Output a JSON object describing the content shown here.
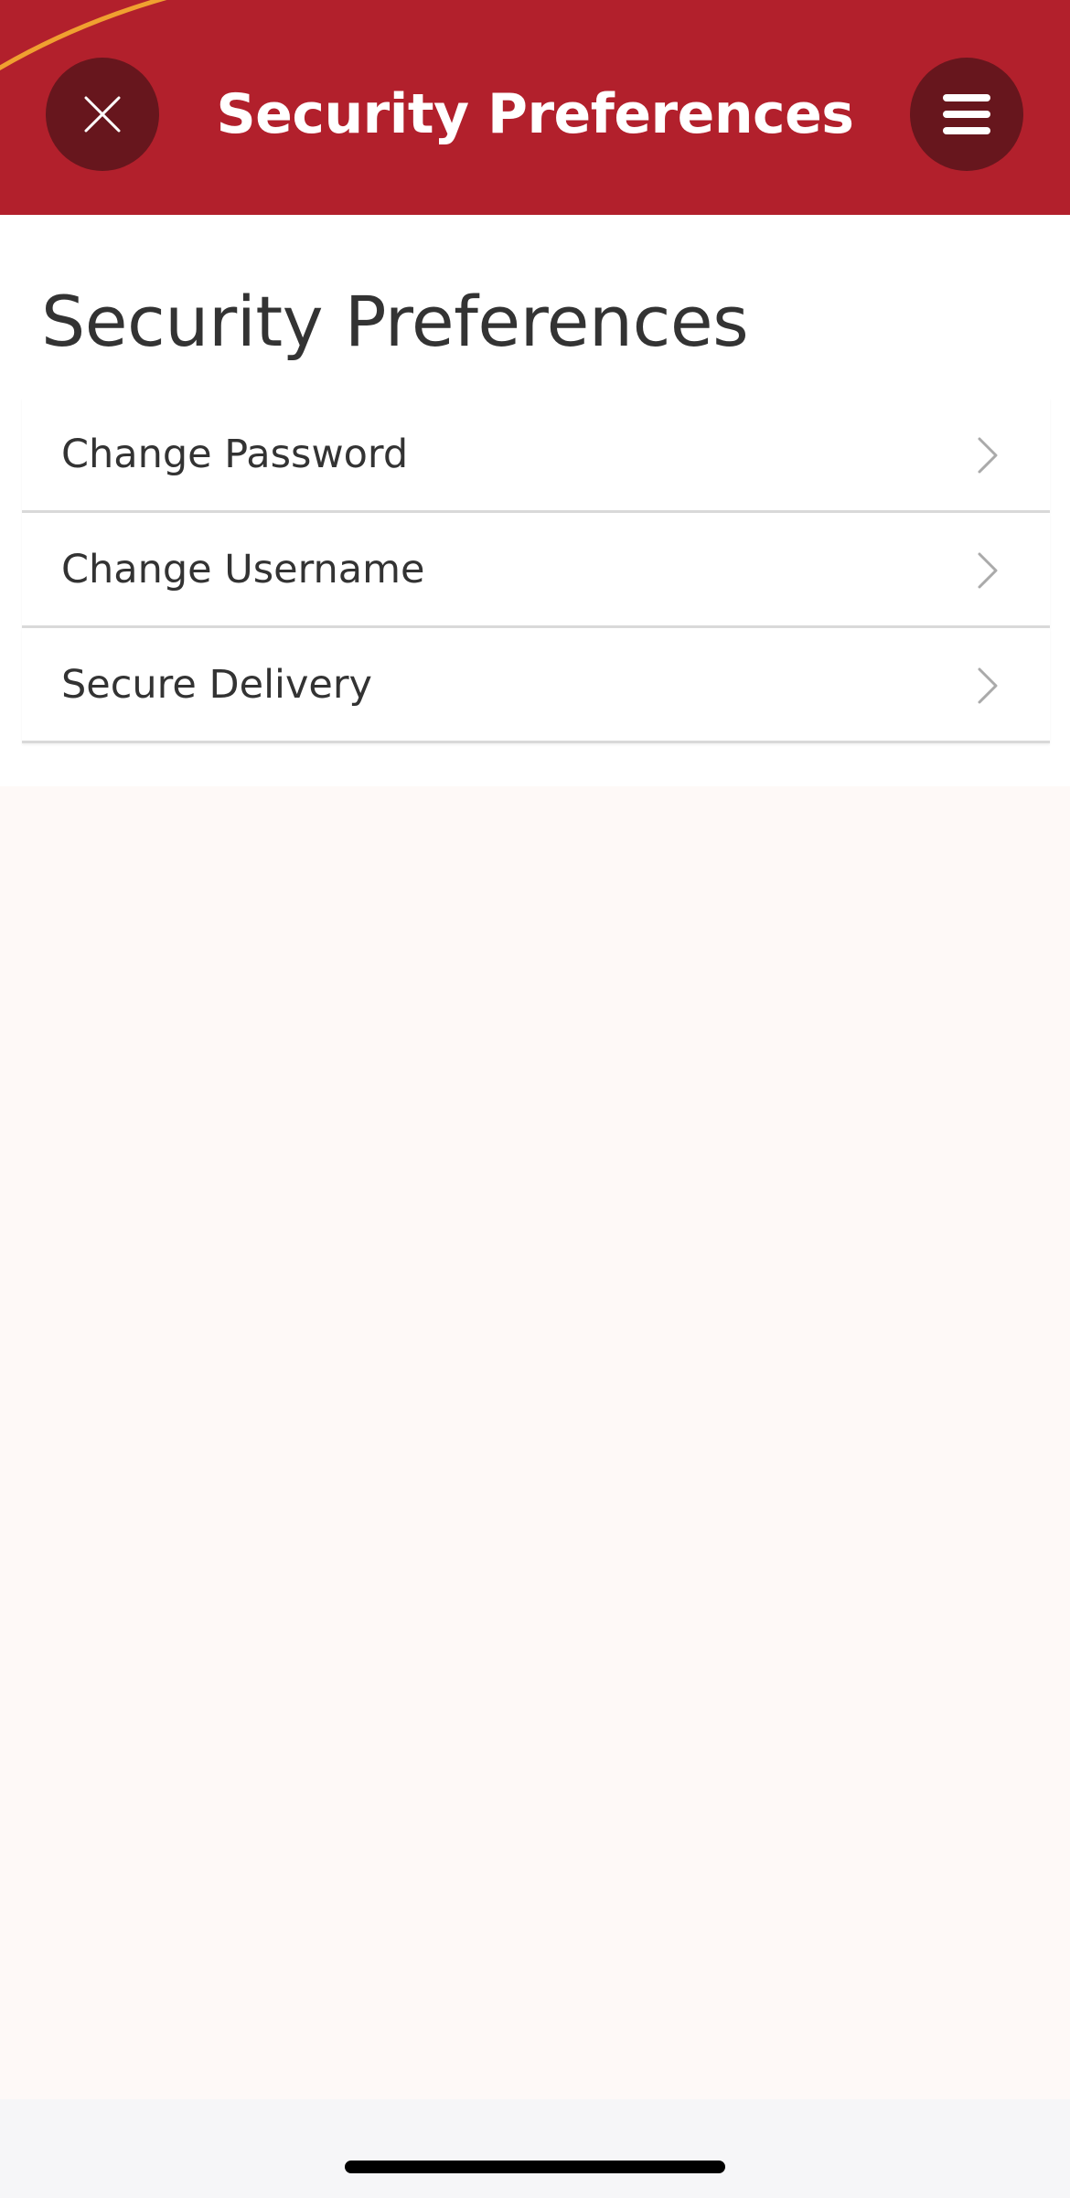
{
  "colors": {
    "header_bg": "#b2202c",
    "header_button_bg": "#67161d",
    "accent_arc": "#f0a030",
    "page_bg_lower": "#fef9f7",
    "home_bar_bg": "#f6f6f8"
  },
  "header": {
    "title": "Security Preferences",
    "close_icon": "close-icon",
    "menu_icon": "hamburger-menu-icon"
  },
  "page": {
    "title": "Security Preferences"
  },
  "menu_items": [
    {
      "label": "Change Password",
      "icon": "chevron-right-icon"
    },
    {
      "label": "Change Username",
      "icon": "chevron-right-icon"
    },
    {
      "label": "Secure Delivery",
      "icon": "chevron-right-icon"
    }
  ]
}
